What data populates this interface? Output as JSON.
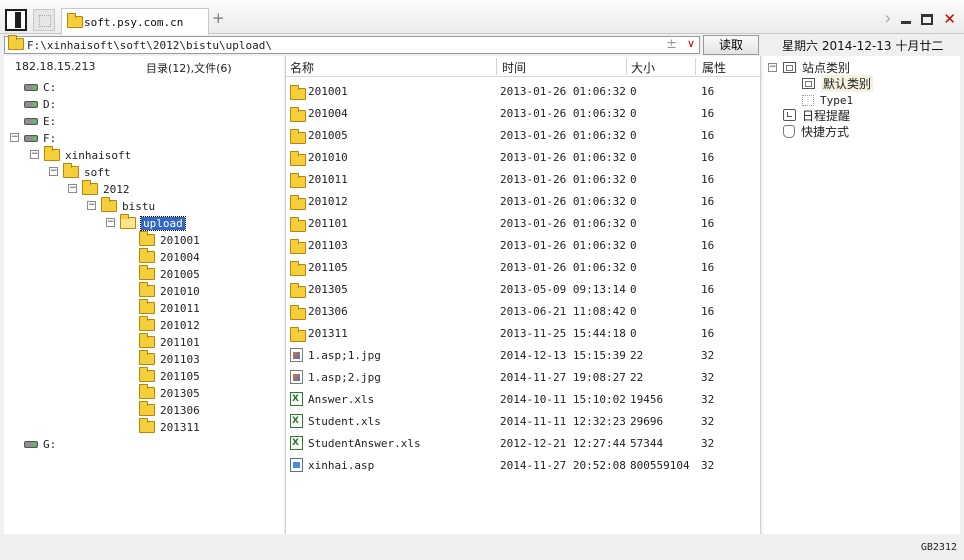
{
  "tabs": {
    "active_title": "soft.psy.com.cn",
    "add_label": "+"
  },
  "window": {
    "nav_chevron": "›",
    "close_glyph": "✕"
  },
  "address": {
    "path": "F:\\xinhaisoft\\soft\\2012\\bistu\\upload\\",
    "sort_glyph": "±",
    "dropdown_glyph": "∨",
    "read_label": "读取"
  },
  "date_line": "星期六  2014-12-13  十月廿二",
  "left": {
    "ip": "182.18.15.213",
    "dir_count": "目录(12),文件(6)",
    "drives": [
      "C:",
      "D:",
      "E:",
      "F:",
      "G:"
    ],
    "tree": [
      "xinhaisoft",
      "soft",
      "2012",
      "bistu",
      "upload"
    ],
    "upload_children": [
      "201001",
      "201004",
      "201005",
      "201010",
      "201011",
      "201012",
      "201101",
      "201103",
      "201105",
      "201305",
      "201306",
      "201311"
    ]
  },
  "list": {
    "headers": {
      "name": "名称",
      "time": "时间",
      "size": "大小",
      "attr": "属性"
    },
    "rows": [
      {
        "name": "201001",
        "time": "2013-01-26 01:06:32",
        "size": "0",
        "attr": "16",
        "icon": "folder-icon"
      },
      {
        "name": "201004",
        "time": "2013-01-26 01:06:32",
        "size": "0",
        "attr": "16",
        "icon": "folder-icon"
      },
      {
        "name": "201005",
        "time": "2013-01-26 01:06:32",
        "size": "0",
        "attr": "16",
        "icon": "folder-icon"
      },
      {
        "name": "201010",
        "time": "2013-01-26 01:06:32",
        "size": "0",
        "attr": "16",
        "icon": "folder-icon"
      },
      {
        "name": "201011",
        "time": "2013-01-26 01:06:32",
        "size": "0",
        "attr": "16",
        "icon": "folder-icon"
      },
      {
        "name": "201012",
        "time": "2013-01-26 01:06:32",
        "size": "0",
        "attr": "16",
        "icon": "folder-icon"
      },
      {
        "name": "201101",
        "time": "2013-01-26 01:06:32",
        "size": "0",
        "attr": "16",
        "icon": "folder-icon"
      },
      {
        "name": "201103",
        "time": "2013-01-26 01:06:32",
        "size": "0",
        "attr": "16",
        "icon": "folder-icon"
      },
      {
        "name": "201105",
        "time": "2013-01-26 01:06:32",
        "size": "0",
        "attr": "16",
        "icon": "folder-icon"
      },
      {
        "name": "201305",
        "time": "2013-05-09 09:13:14",
        "size": "0",
        "attr": "16",
        "icon": "folder-icon"
      },
      {
        "name": "201306",
        "time": "2013-06-21 11:08:42",
        "size": "0",
        "attr": "16",
        "icon": "folder-icon"
      },
      {
        "name": "201311",
        "time": "2013-11-25 15:44:18",
        "size": "0",
        "attr": "16",
        "icon": "folder-icon"
      },
      {
        "name": "1.asp;1.jpg",
        "time": "2014-12-13 15:15:39",
        "size": "22",
        "attr": "32",
        "icon": "image-file-icon"
      },
      {
        "name": "1.asp;2.jpg",
        "time": "2014-11-27 19:08:27",
        "size": "22",
        "attr": "32",
        "icon": "image-file-icon"
      },
      {
        "name": "Answer.xls",
        "time": "2014-10-11 15:10:02",
        "size": "19456",
        "attr": "32",
        "icon": "excel-file-icon"
      },
      {
        "name": "Student.xls",
        "time": "2014-11-11 12:32:23",
        "size": "29696",
        "attr": "32",
        "icon": "excel-file-icon"
      },
      {
        "name": "StudentAnswer.xls",
        "time": "2012-12-21 12:27:44",
        "size": "57344",
        "attr": "32",
        "icon": "excel-file-icon"
      },
      {
        "name": "xinhai.asp",
        "time": "2014-11-27 20:52:08",
        "size": "800559104",
        "attr": "32",
        "icon": "asp-file-icon"
      }
    ]
  },
  "right": {
    "site_category": "站点类别",
    "default_category": "默认类别",
    "type1": "Type1",
    "schedule": "日程提醒",
    "shortcut": "快捷方式"
  },
  "status": {
    "encoding": "GB2312"
  },
  "colors": {
    "selection": "#3167c5",
    "close": "#d00000",
    "folder": "#f5cf3a"
  }
}
